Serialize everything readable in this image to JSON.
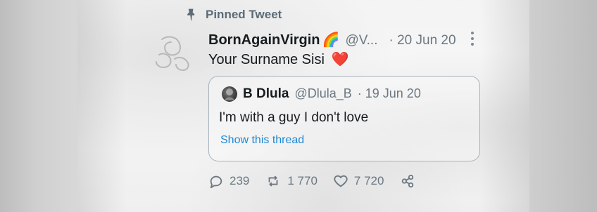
{
  "pinned": {
    "label": "Pinned Tweet"
  },
  "tweet": {
    "display_name": "BornAgainVirgin",
    "emoji": "🌈",
    "handle": "@V...",
    "date": "· 20 Jun 20",
    "text": "Your Surname Sisi",
    "heart": "❤️"
  },
  "quote": {
    "display_name": "B Dlula",
    "handle": "@Dlula_B",
    "date": "· 19 Jun 20",
    "text": "I'm with a guy I don't love",
    "show_thread": "Show this thread"
  },
  "actions": {
    "replies": "239",
    "retweets": "1 770",
    "likes": "7 720"
  },
  "colors": {
    "text": "#151a1d",
    "muted": "#6b7882",
    "link": "#1e88d6",
    "heart": "#e0243b",
    "border": "#a3afb8"
  },
  "icons": {
    "pin": "pin-icon",
    "more": "more-icon",
    "reply": "reply-icon",
    "retweet": "retweet-icon",
    "like": "like-icon",
    "share": "share-icon"
  }
}
